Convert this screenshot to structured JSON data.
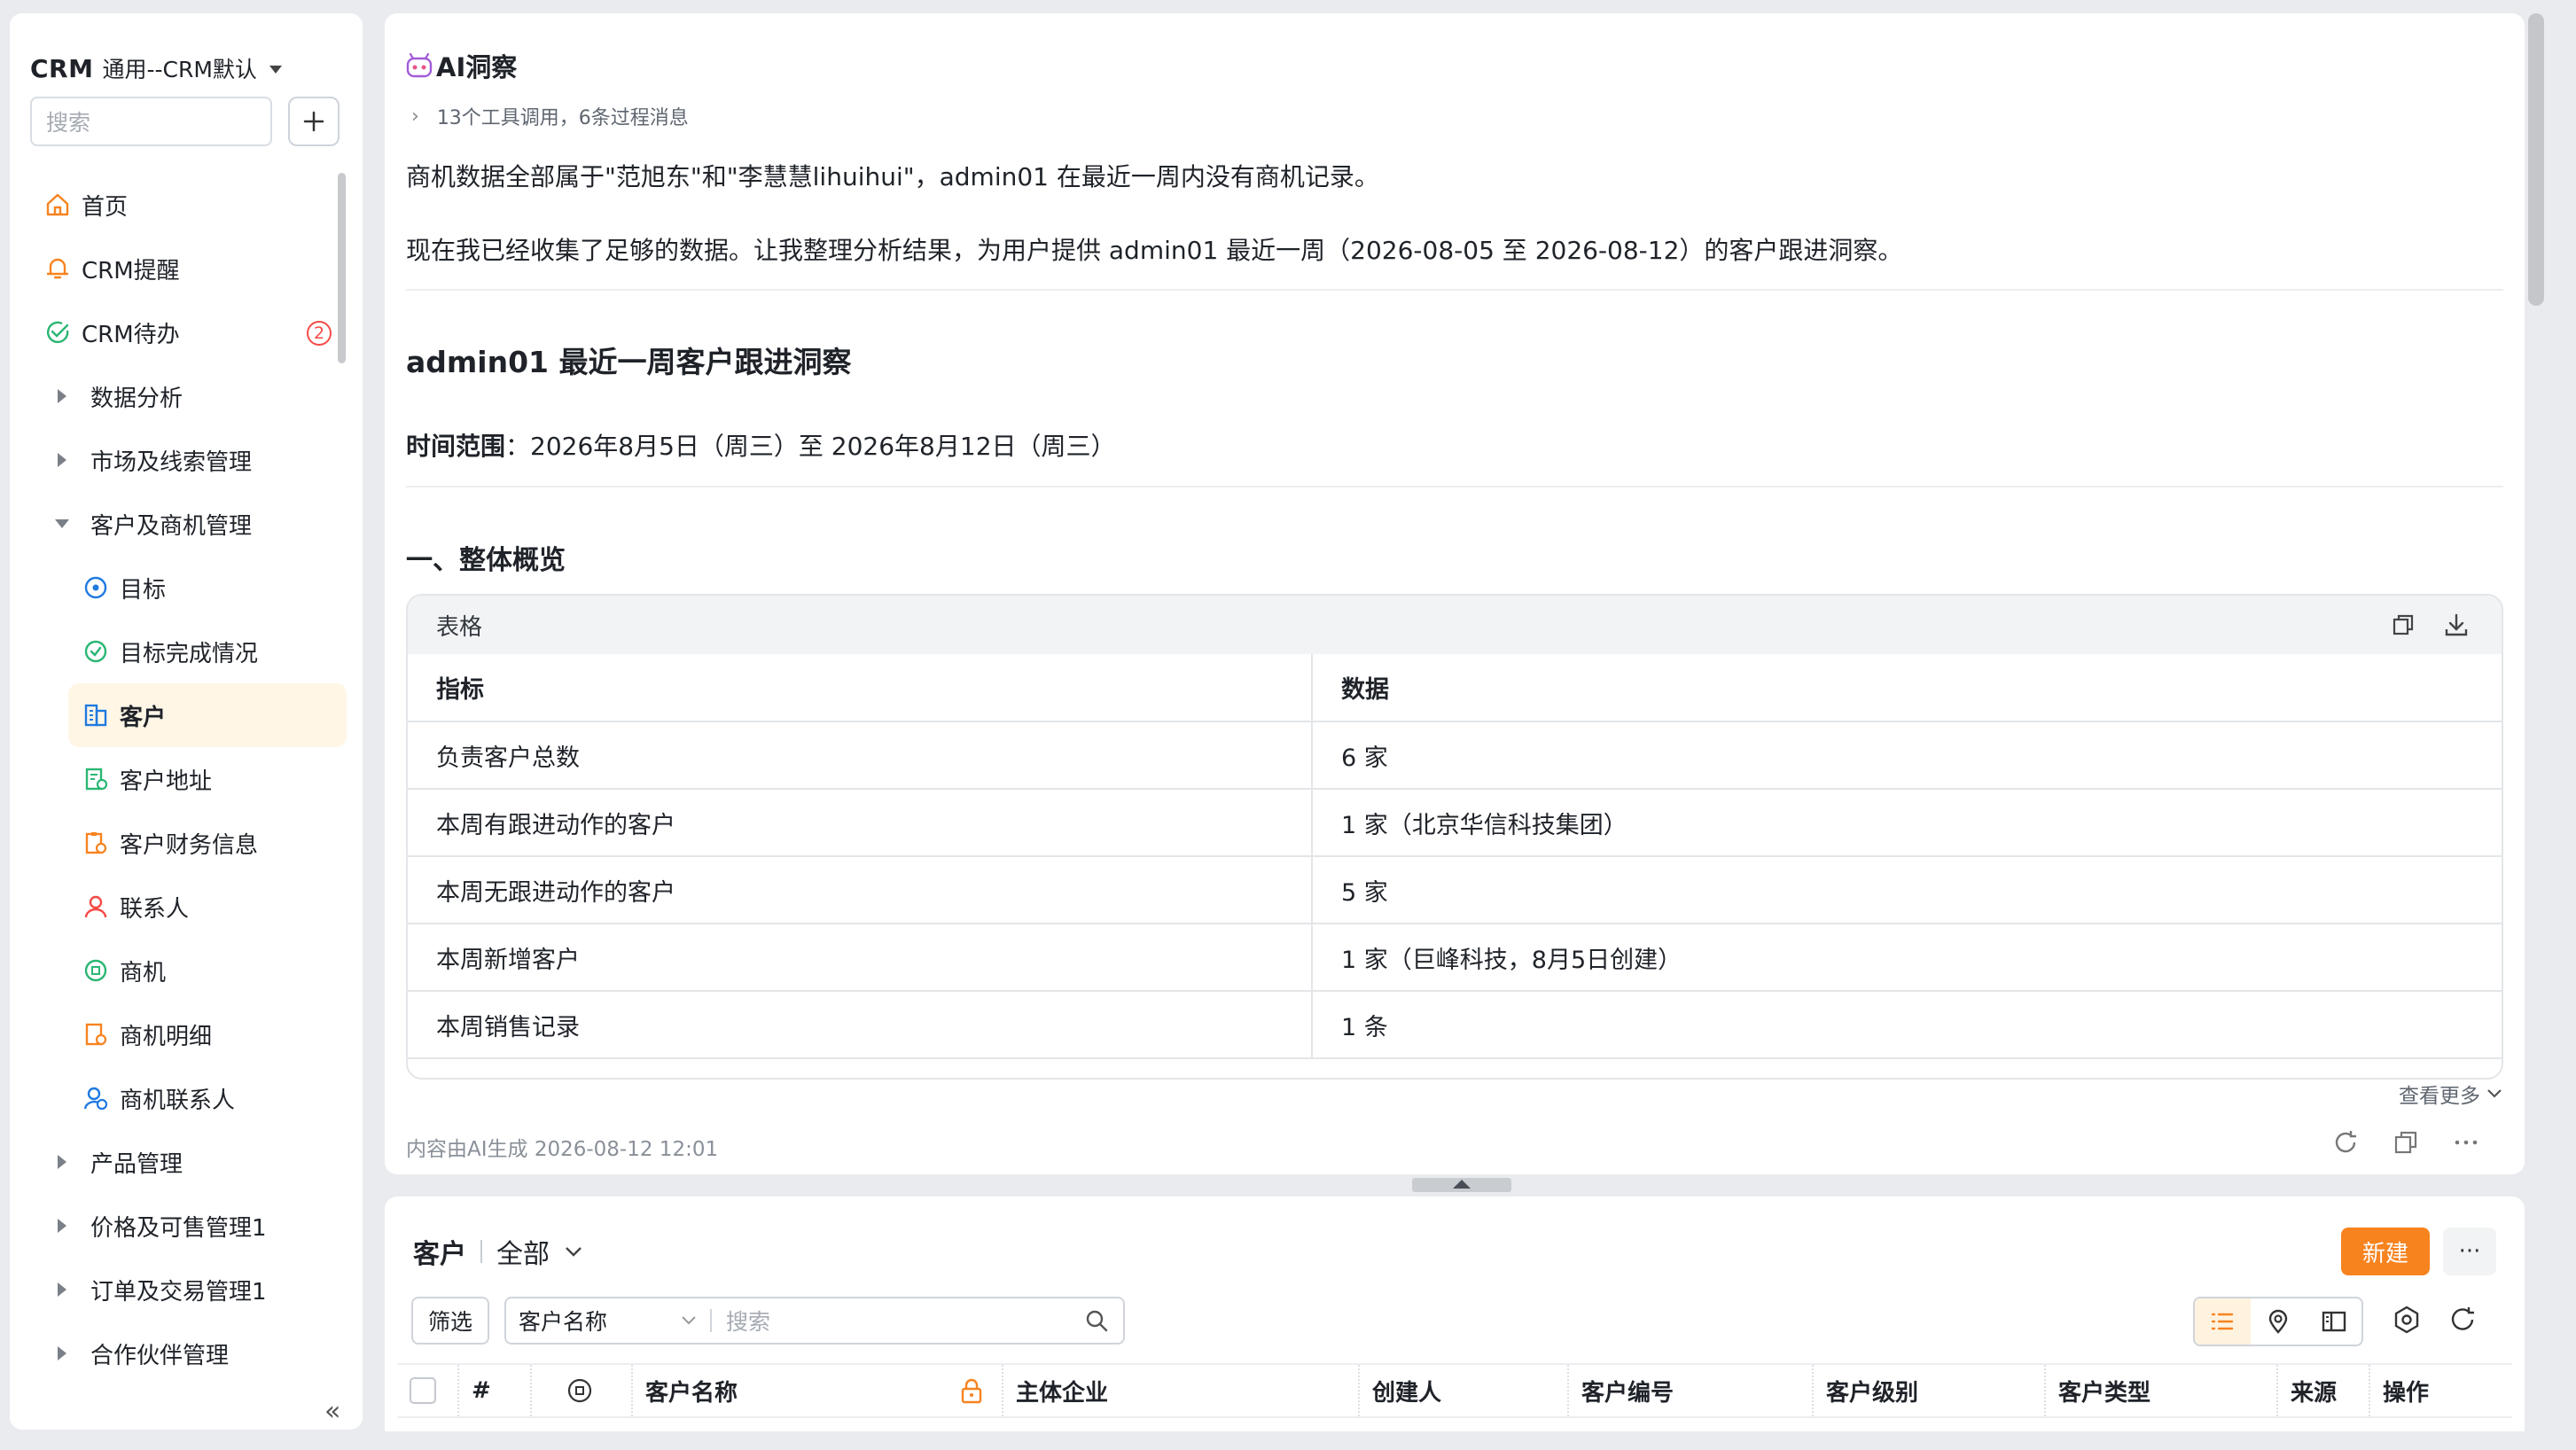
{
  "sidebar": {
    "brand": "CRM",
    "app_name": "通用--CRM默认",
    "search_placeholder": "搜索",
    "items": [
      {
        "label": "首页"
      },
      {
        "label": "CRM提醒"
      },
      {
        "label": "CRM待办",
        "badge": "2"
      },
      {
        "label": "数据分析"
      },
      {
        "label": "市场及线索管理"
      },
      {
        "label": "客户及商机管理"
      },
      {
        "label": "目标"
      },
      {
        "label": "目标完成情况"
      },
      {
        "label": "客户"
      },
      {
        "label": "客户地址"
      },
      {
        "label": "客户财务信息"
      },
      {
        "label": "联系人"
      },
      {
        "label": "商机"
      },
      {
        "label": "商机明细"
      },
      {
        "label": "商机联系人"
      },
      {
        "label": "产品管理"
      },
      {
        "label": "价格及可售管理1"
      },
      {
        "label": "订单及交易管理1"
      },
      {
        "label": "合作伙伴管理"
      }
    ]
  },
  "ai": {
    "title": "AI洞察",
    "tools_summary": "13个工具调用，6条过程消息",
    "p1": "商机数据全部属于\"范旭东\"和\"李慧慧lihuihui\"，admin01 在最近一周内没有商机记录。",
    "p2": "现在我已经收集了足够的数据。让我整理分析结果，为用户提供 admin01 最近一周（2026-08-05 至 2026-08-12）的客户跟进洞察。",
    "h1": "admin01 最近一周客户跟进洞察",
    "range_label": "时间范围",
    "range_value": "：2026年8月5日（周三）至 2026年8月12日（周三）",
    "h2": "一、整体概览",
    "table_title": "表格",
    "table_headers": [
      "指标",
      "数据"
    ],
    "table_rows": [
      [
        "负责客户总数",
        "6 家"
      ],
      [
        "本周有跟进动作的客户",
        "1 家（北京华信科技集团）"
      ],
      [
        "本周无跟进动作的客户",
        "5 家"
      ],
      [
        "本周新增客户",
        "1 家（巨峰科技，8月5日创建）"
      ],
      [
        "本周销售记录",
        "1 条"
      ]
    ],
    "see_more": "查看更多",
    "footer": "内容由AI生成 2026-08-12 12:01"
  },
  "list": {
    "title": "客户",
    "view": "全部",
    "new_button": "新建",
    "more_button": "···",
    "filter_button": "筛选",
    "search_field": "客户名称",
    "search_placeholder": "搜索",
    "columns": [
      "#",
      "客户名称",
      "主体企业",
      "创建人",
      "客户编号",
      "客户级别",
      "客户类型",
      "来源",
      "操作"
    ]
  },
  "colors": {
    "accent": "#f7831f",
    "badge": "#f54a45",
    "active_bg": "#fff6e6"
  }
}
